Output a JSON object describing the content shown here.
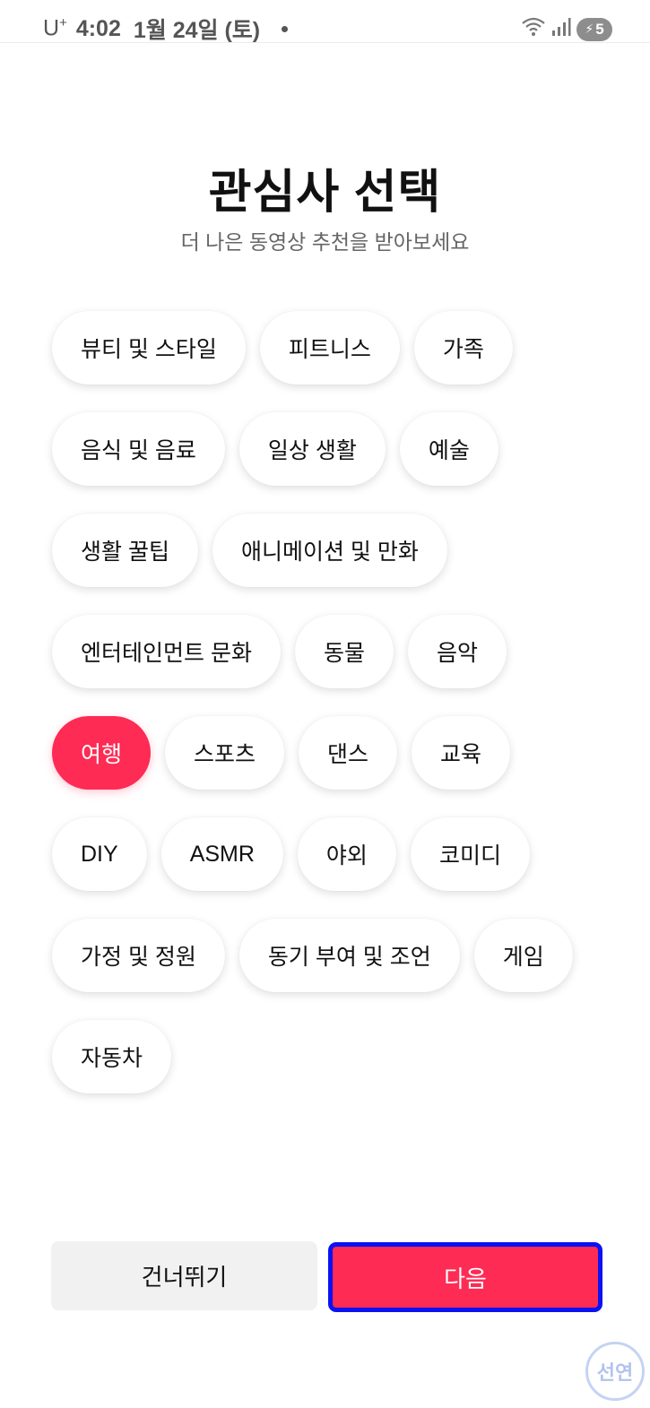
{
  "status_bar": {
    "carrier": "U",
    "carrier_plus": "+",
    "time": "4:02",
    "date": "1월 24일 (토)",
    "battery": "5",
    "icons": [
      "wifi-icon",
      "signal-icon",
      "battery-charging-icon"
    ]
  },
  "header": {
    "title": "관심사 선택",
    "subtitle": "더 나은 동영상 추천을 받아보세요"
  },
  "interests": {
    "rows": [
      [
        {
          "label": "뷰티 및 스타일"
        },
        {
          "label": "피트니스"
        },
        {
          "label": "가족"
        }
      ],
      [
        {
          "label": "음식 및 음료"
        },
        {
          "label": "일상 생활"
        },
        {
          "label": "예술"
        }
      ],
      [
        {
          "label": "생활 꿀팁"
        },
        {
          "label": "애니메이션 및 만화"
        }
      ],
      [
        {
          "label": "엔터테인먼트 문화"
        },
        {
          "label": "동물"
        },
        {
          "label": "음악"
        }
      ],
      [
        {
          "label": "여행",
          "selected": true
        },
        {
          "label": "스포츠"
        },
        {
          "label": "댄스"
        },
        {
          "label": "교육"
        }
      ],
      [
        {
          "label": "DIY"
        },
        {
          "label": "ASMR"
        },
        {
          "label": "야외"
        },
        {
          "label": "코미디"
        }
      ],
      [
        {
          "label": "가정 및 정원"
        },
        {
          "label": "동기 부여 및 조언"
        },
        {
          "label": "게임"
        }
      ],
      [
        {
          "label": "자동차"
        }
      ]
    ]
  },
  "footer": {
    "skip_label": "건너뛰기",
    "next_label": "다음"
  },
  "watermark": "선연",
  "colors": {
    "accent": "#fe2b54",
    "focus_border": "#0b12f2",
    "skip_bg": "#f1f1f1"
  }
}
